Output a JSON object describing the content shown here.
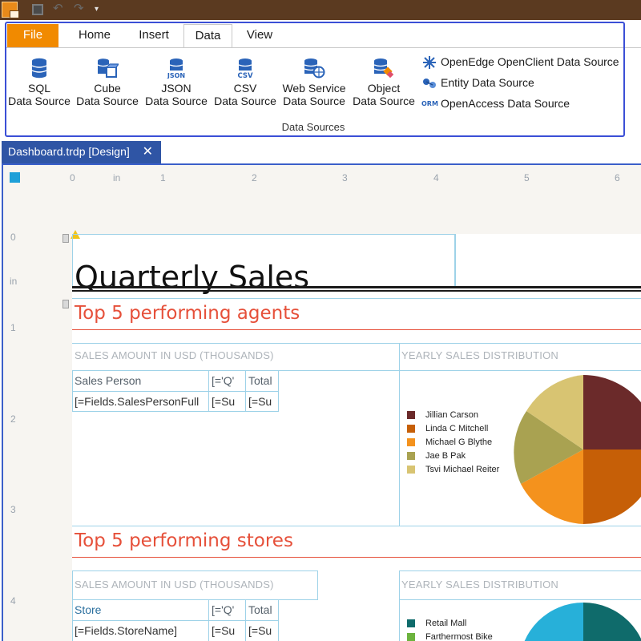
{
  "quick_access": {
    "save_icon": "save-icon",
    "undo_icon": "undo-icon",
    "redo_icon": "redo-icon",
    "customize_icon": "customize-toolbar-icon"
  },
  "ribbon": {
    "tabs": [
      {
        "label": "File"
      },
      {
        "label": "Home"
      },
      {
        "label": "Insert"
      },
      {
        "label": "Data"
      },
      {
        "label": "View"
      }
    ],
    "active_tab": "Data",
    "data_sources": [
      {
        "line1": "SQL",
        "line2": "Data Source",
        "icon": "database-icon"
      },
      {
        "line1": "Cube",
        "line2": "Data Source",
        "icon": "cube-database-icon"
      },
      {
        "line1": "JSON",
        "line2": "Data Source",
        "icon": "json-database-icon"
      },
      {
        "line1": "CSV",
        "line2": "Data Source",
        "icon": "csv-database-icon"
      },
      {
        "line1": "Web Service",
        "line2": "Data Source",
        "icon": "web-service-database-icon"
      },
      {
        "line1": "Object",
        "line2": "Data Source",
        "icon": "object-database-icon"
      }
    ],
    "small_sources": [
      {
        "label": "OpenEdge OpenClient Data Source",
        "icon": "openedge-icon"
      },
      {
        "label": "Entity Data Source",
        "icon": "entity-icon"
      },
      {
        "label": "OpenAccess Data Source",
        "icon": "orm-icon",
        "icon_text": "ORM"
      }
    ],
    "group_label": "Data Sources"
  },
  "document": {
    "tab_label": "Dashboard.trdp [Design]",
    "close_glyph": "✕"
  },
  "ruler": {
    "h_labels": [
      "0",
      "in",
      "1",
      "2",
      "3",
      "4",
      "5",
      "6"
    ],
    "v_labels": [
      "0",
      "in",
      "1",
      "2",
      "3",
      "4"
    ]
  },
  "report": {
    "title": "Quarterly Sales",
    "sections": [
      {
        "heading": "Top 5 performing agents",
        "left_caption": "SALES AMOUNT IN USD (THOUSANDS)",
        "right_caption": "YEARLY SALES DISTRIBUTION",
        "table_header": [
          "Sales Person",
          "[='Q'",
          "Total"
        ],
        "table_row": [
          "[=Fields.SalesPersonFull",
          "[=Su",
          "[=Su"
        ],
        "legend": [
          {
            "label": "Jillian  Carson",
            "color": "#6b2a2a"
          },
          {
            "label": "Linda C Mitchell",
            "color": "#c65f07"
          },
          {
            "label": "Michael G Blythe",
            "color": "#f4921d"
          },
          {
            "label": "Jae B Pak",
            "color": "#a9a251"
          },
          {
            "label": "Tsvi Michael Reiter",
            "color": "#d8c472"
          }
        ]
      },
      {
        "heading": "Top 5 performing stores",
        "left_caption": "SALES AMOUNT IN USD (THOUSANDS)",
        "right_caption": "YEARLY SALES DISTRIBUTION",
        "table_header": [
          "Store",
          "[='Q'",
          "Total"
        ],
        "table_row": [
          "[=Fields.StoreName]",
          "[=Su",
          "[=Su"
        ],
        "legend": [
          {
            "label": "Retail Mall",
            "color": "#0f6b6b"
          },
          {
            "label": "Farthermost Bike",
            "color": "#6cb33e"
          }
        ]
      }
    ]
  },
  "colors": {
    "file_tab": "#f18a00",
    "title_bar": "#5b3a20",
    "doc_tab": "#2f55a5",
    "section_heading": "#e6503a",
    "guide": "#9ed2e8"
  }
}
